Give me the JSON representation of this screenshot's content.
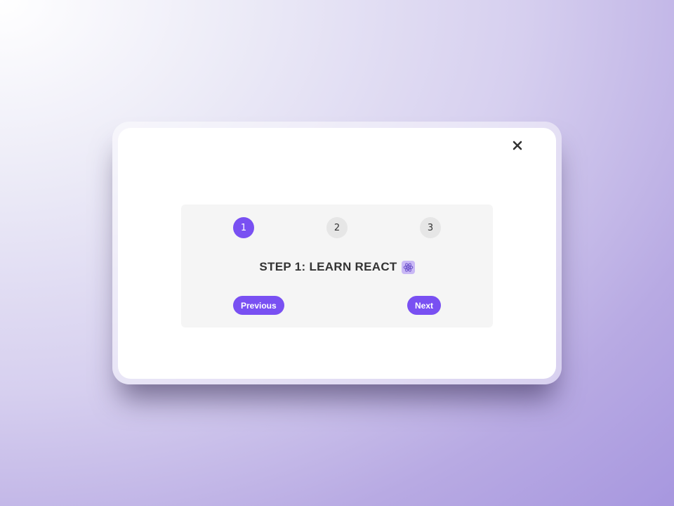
{
  "steps": [
    {
      "number": "1",
      "active": true
    },
    {
      "number": "2",
      "active": false
    },
    {
      "number": "3",
      "active": false
    }
  ],
  "message": "STEP 1: LEARN REACT",
  "message_icon": "react-atom-icon",
  "buttons": {
    "previous_label": "Previous",
    "next_label": "Next"
  },
  "close_icon": "close-icon",
  "colors": {
    "accent": "#7950f2",
    "inactive_step": "#e6e6e6",
    "card_bg": "#f5f5f5",
    "text": "#333333"
  }
}
